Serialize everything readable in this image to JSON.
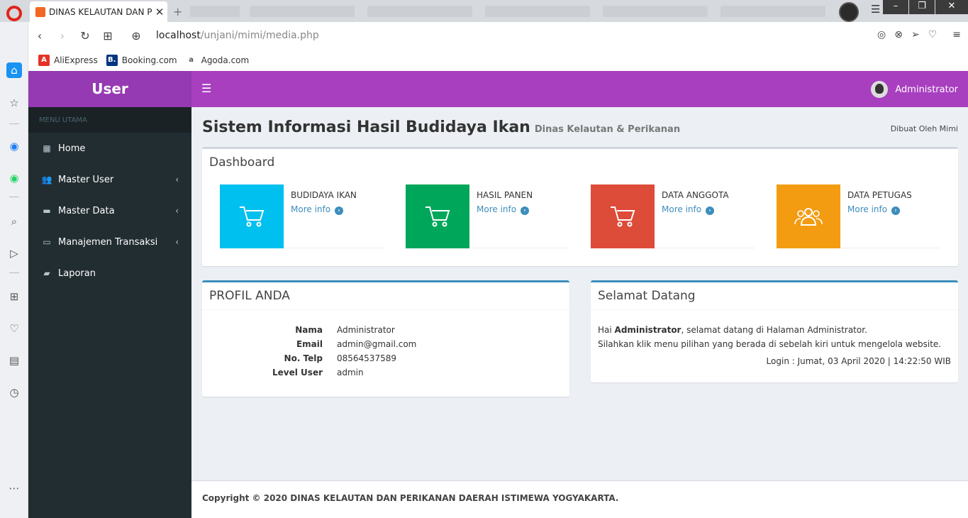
{
  "browser": {
    "active_tab_title": "DINAS KELAUTAN DAN PERIKANAN",
    "url_host": "localhost",
    "url_path": "/unjani/mimi/media.php",
    "bookmarks": [
      {
        "label": "AliExpress",
        "color": "#e43225",
        "glyph": "A"
      },
      {
        "label": "Booking.com",
        "color": "#003580",
        "glyph": "B."
      },
      {
        "label": "Agoda.com",
        "color": "#555555",
        "glyph": "a"
      }
    ]
  },
  "app": {
    "brand": "User",
    "admin_name": "Administrator",
    "sidebar": {
      "header": "MENU UTAMA",
      "items": [
        {
          "label": "Home",
          "icon": "th-icon",
          "glyph": "▦",
          "caret": ""
        },
        {
          "label": "Master User",
          "icon": "users-icon",
          "glyph": "👥",
          "caret": "‹"
        },
        {
          "label": "Master Data",
          "icon": "folder-icon",
          "glyph": "▬",
          "caret": "‹"
        },
        {
          "label": "Manajemen Transaksi",
          "icon": "laptop-icon",
          "glyph": "▭",
          "caret": "‹"
        },
        {
          "label": "Laporan",
          "icon": "book-icon",
          "glyph": "▰",
          "caret": ""
        }
      ]
    },
    "page": {
      "title": "Sistem Informasi Hasil Budidaya Ikan",
      "subtitle": "Dinas Kelautan & Perikanan",
      "credit": "Dibuat Oleh Mimi"
    },
    "dashboard": {
      "title": "Dashboard",
      "cards": [
        {
          "label": "BUDIDAYA IKAN",
          "link": "More info",
          "color": "#00c0ef",
          "icon": "cart-icon"
        },
        {
          "label": "HASIL PANEN",
          "link": "More info",
          "color": "#00a65a",
          "icon": "cart-icon"
        },
        {
          "label": "DATA ANGGOTA",
          "link": "More info",
          "color": "#dd4b39",
          "icon": "cart-icon"
        },
        {
          "label": "DATA PETUGAS",
          "link": "More info",
          "color": "#f39c12",
          "icon": "users-icon"
        }
      ]
    },
    "profile": {
      "title": "PROFIL ANDA",
      "rows": [
        {
          "label": "Nama",
          "value": "Administrator"
        },
        {
          "label": "Email",
          "value": "admin@gmail.com"
        },
        {
          "label": "No. Telp",
          "value": "08564537589"
        },
        {
          "label": "Level User",
          "value": "admin"
        }
      ]
    },
    "welcome": {
      "title": "Selamat Datang",
      "greeting_prefix": "Hai ",
      "greeting_name": "Administrator",
      "greeting_suffix": ", selamat datang di Halaman Administrator.",
      "line2": "Silahkan klik menu pilihan yang berada di sebelah kiri untuk mengelola website.",
      "login": "Login : Jumat, 03 April 2020 | 14:22:50 WIB"
    },
    "footer": {
      "prefix": "Copyright © 2020 ",
      "org": "DINAS KELAUTAN DAN PERIKANAN DAERAH ISTIMEWA YOGYAKARTA."
    }
  }
}
